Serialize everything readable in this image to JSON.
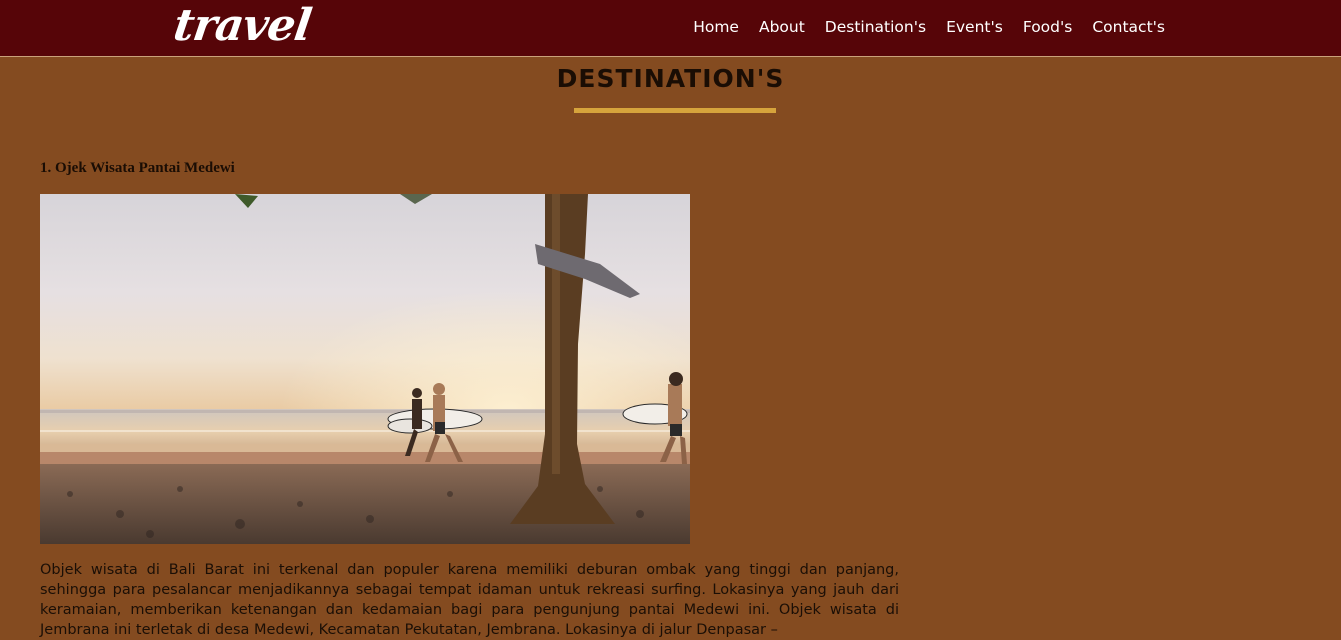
{
  "header": {
    "logo": "travel",
    "nav": [
      {
        "label": "Home"
      },
      {
        "label": "About"
      },
      {
        "label": "Destination's"
      },
      {
        "label": "Event's"
      },
      {
        "label": "Food's"
      },
      {
        "label": "Contact's"
      }
    ]
  },
  "page": {
    "title": "DESTINATION'S",
    "accent_color": "#d6a43c",
    "background_color": "#844b20",
    "header_color": "#560508"
  },
  "destination": {
    "heading": "1. Ojek Wisata Pantai Medewi",
    "image_icon": "beach-surfers-photo",
    "description": "Objek wisata di Bali Barat ini terkenal dan populer karena memiliki deburan ombak yang tinggi dan panjang, sehingga para pesalancar menjadikannya sebagai tempat idaman untuk rekreasi surfing. Lokasinya yang jauh dari keramaian, memberikan ketenangan dan kedamaian bagi para pengunjung pantai Medewi ini. Objek wisata di Jembrana ini terletak di desa Medewi, Kecamatan Pekutatan, Jembrana. Lokasinya di jalur Denpasar –"
  }
}
